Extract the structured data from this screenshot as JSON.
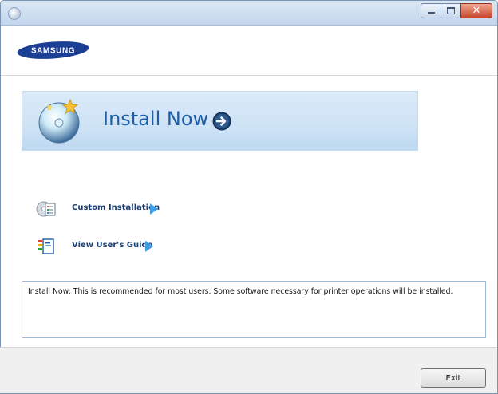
{
  "window": {
    "controls": {
      "minimize_icon": "minimize-icon",
      "maximize_icon": "maximize-icon",
      "close_icon": "close-icon",
      "close_glyph": "✕"
    }
  },
  "header": {
    "logo_text": "SAMSUNG",
    "brand_color": "#1b3f95"
  },
  "main": {
    "install_now": {
      "label": "Install Now",
      "icon": "install-disc-icon",
      "action_icon": "arrow-right-icon"
    },
    "options": [
      {
        "label": "Custom Installation",
        "icon": "custom-install-icon"
      },
      {
        "label": "View User's Guide",
        "icon": "user-guide-icon"
      }
    ],
    "description": "Install Now: This is recommended for most users. Some software necessary for printer operations will be installed."
  },
  "footer": {
    "exit_label": "Exit"
  },
  "colors": {
    "banner_bg": "#cfe3f6",
    "install_text": "#1f5ea5",
    "option_text": "#1a3f73",
    "option_arrow": "#3d9ee8"
  }
}
